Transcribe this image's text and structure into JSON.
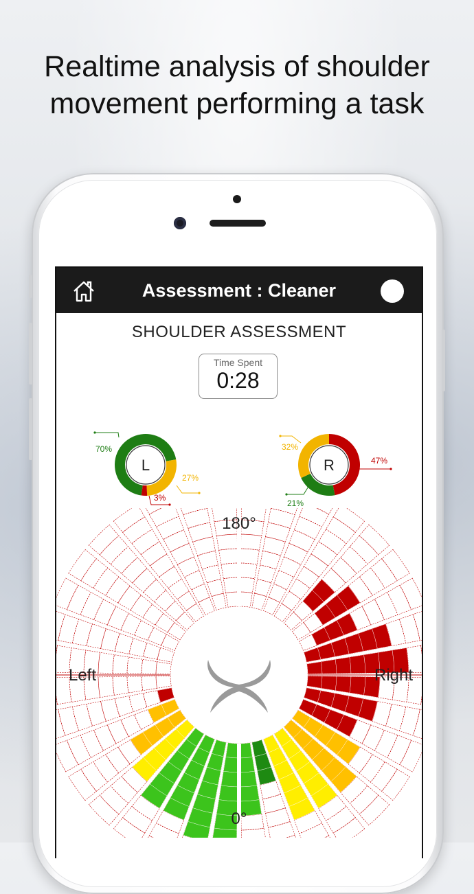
{
  "headline": {
    "line1": "Realtime analysis of shoulder",
    "line2": "movement performing a task"
  },
  "nav": {
    "title": "Assessment : Cleaner",
    "home_icon": "home-icon",
    "right_icon": "circle-button"
  },
  "section_title": "SHOULDER ASSESSMENT",
  "time": {
    "label": "Time Spent",
    "value": "0:28"
  },
  "left_donut": {
    "label": "L",
    "slices": [
      {
        "name": "green",
        "percent": 70,
        "label": "70%",
        "color": "#1e7d14"
      },
      {
        "name": "yellow",
        "percent": 27,
        "label": "27%",
        "color": "#f2b400"
      },
      {
        "name": "red",
        "percent": 3,
        "label": "3%",
        "color": "#c00000"
      }
    ]
  },
  "right_donut": {
    "label": "R",
    "slices": [
      {
        "name": "red",
        "percent": 47,
        "label": "47%",
        "color": "#c00000"
      },
      {
        "name": "green",
        "percent": 21,
        "label": "21%",
        "color": "#1e7d14"
      },
      {
        "name": "yellow",
        "percent": 32,
        "label": "32%",
        "color": "#f2b400"
      }
    ]
  },
  "polar": {
    "top_label": "180°",
    "bottom_label": "0°",
    "left_label": "Left",
    "right_label": "Right"
  },
  "colors": {
    "red": "#c00000",
    "redBright": "#e00000",
    "yellow": "#ffc000",
    "yellowLight": "#ffee00",
    "green": "#3cc41c",
    "greenDark": "#1e8a12"
  }
}
